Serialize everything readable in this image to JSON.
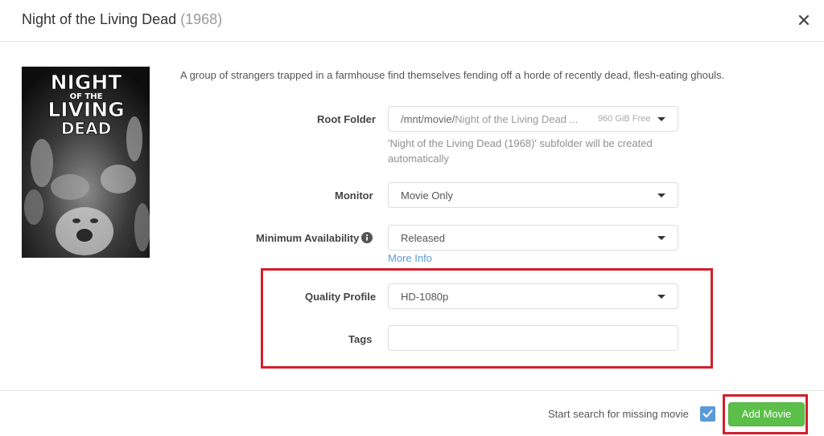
{
  "header": {
    "title": "Night of the Living Dead",
    "year": "(1968)"
  },
  "poster": {
    "title_line1": "NIGHT",
    "title_line2": "OF THE",
    "title_line3": "LIVING",
    "title_line4": "DEAD"
  },
  "overview": "A group of strangers trapped in a farmhouse find themselves fending off a horde of recently dead, flesh-eating ghouls.",
  "form": {
    "root_folder": {
      "label": "Root Folder",
      "path_prefix": "/mnt/movie/",
      "path_rest": "Night of the Living Dead ...",
      "free_space": "960 GiB Free",
      "help": "'Night of the Living Dead (1968)' subfolder will be created automatically"
    },
    "monitor": {
      "label": "Monitor",
      "value": "Movie Only"
    },
    "minimum_availability": {
      "label": "Minimum Availability",
      "value": "Released",
      "more_info": "More Info"
    },
    "quality_profile": {
      "label": "Quality Profile",
      "value": "HD-1080p"
    },
    "tags": {
      "label": "Tags",
      "value": ""
    }
  },
  "footer": {
    "search_label": "Start search for missing movie",
    "search_checked": true,
    "add_button": "Add Movie"
  },
  "colors": {
    "accent": "#5b9bd5",
    "add_button": "#5bbf4a",
    "highlight": "#d21f2b"
  }
}
